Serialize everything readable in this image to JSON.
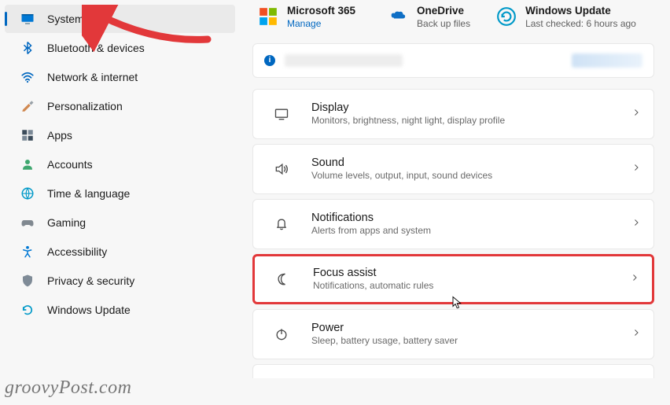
{
  "sidebar": {
    "items": [
      {
        "label": "System"
      },
      {
        "label": "Bluetooth & devices"
      },
      {
        "label": "Network & internet"
      },
      {
        "label": "Personalization"
      },
      {
        "label": "Apps"
      },
      {
        "label": "Accounts"
      },
      {
        "label": "Time & language"
      },
      {
        "label": "Gaming"
      },
      {
        "label": "Accessibility"
      },
      {
        "label": "Privacy & security"
      },
      {
        "label": "Windows Update"
      }
    ]
  },
  "top": {
    "ms365": {
      "title": "Microsoft 365",
      "sub": "Manage"
    },
    "onedrive": {
      "title": "OneDrive",
      "sub": "Back up files"
    },
    "wu": {
      "title": "Windows Update",
      "sub": "Last checked: 6 hours ago"
    }
  },
  "cards": [
    {
      "title": "Display",
      "sub": "Monitors, brightness, night light, display profile"
    },
    {
      "title": "Sound",
      "sub": "Volume levels, output, input, sound devices"
    },
    {
      "title": "Notifications",
      "sub": "Alerts from apps and system"
    },
    {
      "title": "Focus assist",
      "sub": "Notifications, automatic rules"
    },
    {
      "title": "Power",
      "sub": "Sleep, battery usage, battery saver"
    }
  ],
  "watermark": "groovyPost.com"
}
